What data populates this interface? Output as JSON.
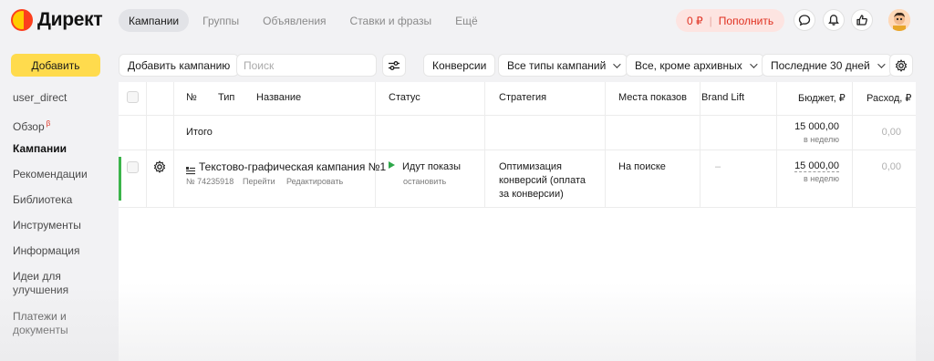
{
  "header": {
    "logo_text": "Директ",
    "tabs": [
      {
        "label": "Кампании",
        "active": true
      },
      {
        "label": "Группы",
        "active": false
      },
      {
        "label": "Объявления",
        "active": false
      },
      {
        "label": "Ставки и фразы",
        "active": false
      },
      {
        "label": "Ещё",
        "active": false
      }
    ],
    "balance": "0 ₽",
    "topup_label": "Пополнить",
    "icons": [
      "chat-icon",
      "bell-icon",
      "thumbs-up-icon"
    ]
  },
  "sidebar": {
    "add_button": "Добавить",
    "items": [
      {
        "label": "user_direct"
      },
      {
        "label": "Обзор",
        "badge": "β"
      },
      {
        "label": "Кампании",
        "active": true
      },
      {
        "label": "Рекомендации"
      },
      {
        "label": "Библиотека"
      },
      {
        "label": "Инструменты"
      },
      {
        "label": "Информация"
      },
      {
        "label": "Идеи для улучшения"
      },
      {
        "label": "Платежи и документы"
      }
    ]
  },
  "toolbar": {
    "add_campaign": "Добавить кампанию",
    "search_placeholder": "Поиск",
    "conversions": "Конверсии",
    "campaign_types": "Все типы кампаний",
    "archive_filter": "Все, кроме архивных",
    "period": "Последние 30 дней"
  },
  "table": {
    "columns": [
      "№",
      "Тип",
      "Название",
      "Статус",
      "Стратегия",
      "Места показов",
      "Brand Lift",
      "Бюджет, ₽",
      "Расход, ₽"
    ],
    "total": {
      "label": "Итого",
      "budget": "15 000,00",
      "budget_period": "в неделю",
      "spend": "0,00"
    },
    "rows": [
      {
        "name": "Текстово-графическая кампания №1",
        "number": "№ 74235918",
        "action_go": "Перейти",
        "action_edit": "Редактировать",
        "status": "Идут показы",
        "status_action": "остановить",
        "strategy": "Оптимизация конверсий (оплата за конверсии)",
        "strategy_lines": [
          "Оптимизация",
          "конверсий (оплата",
          "за конверсии)"
        ],
        "placements": "На поиске",
        "brand_lift": "–",
        "budget": "15 000,00",
        "budget_period": "в неделю",
        "spend": "0,00"
      }
    ]
  },
  "colors": {
    "accent_yellow": "#ffdb4d",
    "status_green": "#3bb44a",
    "balance_red": "#e03020"
  }
}
